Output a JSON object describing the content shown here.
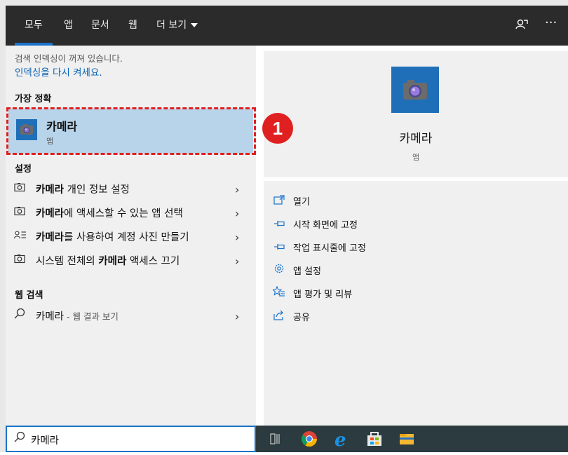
{
  "tabs": [
    {
      "label": "모두"
    },
    {
      "label": "앱"
    },
    {
      "label": "문서"
    },
    {
      "label": "웹"
    },
    {
      "label": "더 보기"
    }
  ],
  "topbar_icons": [
    "feedback-icon",
    "more-icon"
  ],
  "notice": {
    "line1": "검색 인덱싱이 꺼져 있습니다.",
    "link": "인덱싱을 다시 켜세요."
  },
  "best_match": {
    "section_title": "가장 정확",
    "title": "카메라",
    "type": "앱"
  },
  "settings": {
    "section_title": "설정",
    "items": [
      {
        "icon": "camera-privacy-icon",
        "bold": "카메라",
        "rest": " 개인 정보 설정"
      },
      {
        "icon": "camera-privacy-icon",
        "bold": "카메라",
        "rest": "에 액세스할 수 있는 앱 선택"
      },
      {
        "icon": "account-icon",
        "bold": "카메라",
        "rest": "를 사용하여 계정 사진 만들기"
      },
      {
        "icon": "camera-privacy-icon",
        "pre": "시스템 전체의 ",
        "bold": "카메라",
        "rest": " 액세스 끄기"
      }
    ]
  },
  "web": {
    "section_title": "웹 검색",
    "query": "카메라",
    "suffix": " - 웹 결과 보기"
  },
  "preview": {
    "title": "카메라",
    "type": "앱",
    "actions": [
      {
        "icon": "open-icon",
        "label": "열기"
      },
      {
        "icon": "pin-icon",
        "label": "시작 화면에 고정"
      },
      {
        "icon": "pin-icon",
        "label": "작업 표시줄에 고정"
      },
      {
        "icon": "gear-icon",
        "label": "앱 설정"
      },
      {
        "icon": "star-icon",
        "label": "앱 평가 및 리뷰"
      },
      {
        "icon": "share-icon",
        "label": "공유"
      }
    ]
  },
  "search": {
    "value": "카메라"
  },
  "annotation": {
    "number": "1"
  },
  "colors": {
    "accent": "#1a73c8",
    "highlight": "#b8d4ea",
    "marker_red": "#e02020",
    "topbar": "#2b2b2b",
    "taskbar": "#2b3b3f"
  },
  "taskbar_icons": [
    "task-view-icon",
    "chrome-icon",
    "edge-icon",
    "store-icon",
    "file-explorer-icon"
  ]
}
